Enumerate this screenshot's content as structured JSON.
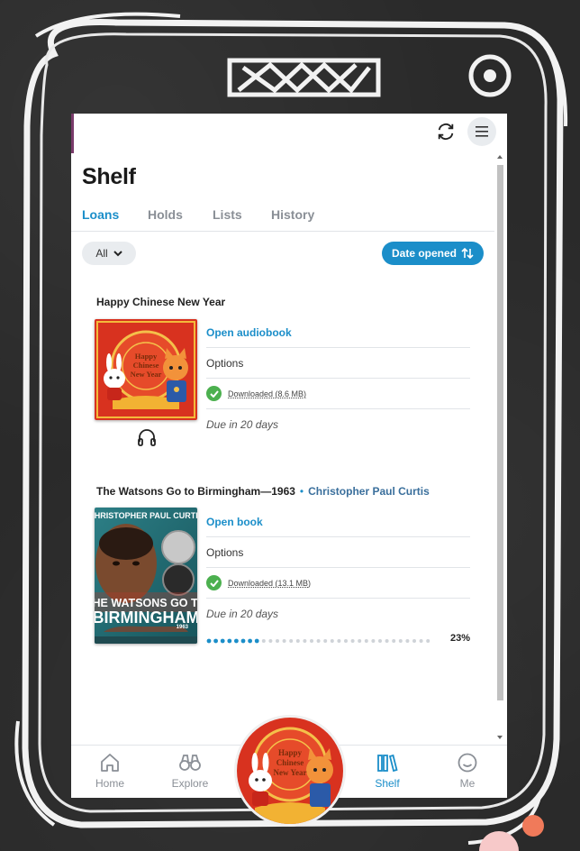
{
  "header": {
    "sync_icon": "sync-icon",
    "menu_icon": "hamburger-menu-icon"
  },
  "page_title": "Shelf",
  "tabs": [
    {
      "label": "Loans",
      "active": true
    },
    {
      "label": "Holds",
      "active": false
    },
    {
      "label": "Lists",
      "active": false
    },
    {
      "label": "History",
      "active": false
    }
  ],
  "filter": {
    "label": "All",
    "icon": "chevron-down-icon"
  },
  "sort": {
    "label": "Date opened",
    "icon": "sort-arrows-icon"
  },
  "books": [
    {
      "title": "Happy Chinese New Year",
      "author": "",
      "cover_text": [
        "Happy",
        "Chinese",
        "New Year"
      ],
      "open_label": "Open audiobook",
      "options_label": "Options",
      "download_label": "Downloaded (8.6 MB)",
      "due_label": "Due in 20 days",
      "format_icon": "headphones-icon"
    },
    {
      "title": "The Watsons Go to Birmingham—1963",
      "author": "Christopher Paul Curtis",
      "cover_author": "CHRISTOPHER PAUL CURTIS",
      "cover_title_1": "THE WATSONS GO TO",
      "cover_title_2": "BIRMINGHAM",
      "cover_year": "1963",
      "open_label": "Open book",
      "options_label": "Options",
      "download_label": "Downloaded (13.1 MB)",
      "due_label": "Due in 20 days",
      "progress_percent": 23,
      "progress_label": "23%"
    }
  ],
  "nav": [
    {
      "label": "Home",
      "icon": "home-icon",
      "active": false
    },
    {
      "label": "Explore",
      "icon": "binoculars-icon",
      "active": false
    },
    {
      "label": "Shelf",
      "icon": "books-icon",
      "active": true
    },
    {
      "label": "Me",
      "icon": "smiley-icon",
      "active": false
    }
  ],
  "now_playing": {
    "cover_text": [
      "Happy",
      "Chinese",
      "New Year"
    ]
  },
  "colors": {
    "accent": "#1b8ec9",
    "check": "#4cb04f",
    "board": "#2a2a2a",
    "cover_red": "#d8321f"
  }
}
